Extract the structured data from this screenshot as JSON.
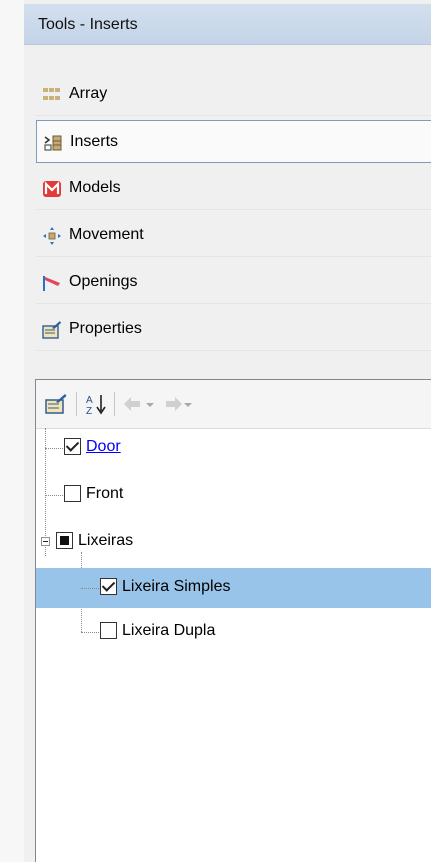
{
  "window": {
    "title": "Tools - Inserts"
  },
  "tools": {
    "items": [
      {
        "label": "Array",
        "icon": "array-icon"
      },
      {
        "label": "Inserts",
        "icon": "inserts-icon",
        "selected": true
      },
      {
        "label": "Models",
        "icon": "models-icon"
      },
      {
        "label": "Movement",
        "icon": "movement-icon"
      },
      {
        "label": "Openings",
        "icon": "openings-icon"
      },
      {
        "label": "Properties",
        "icon": "properties-icon"
      }
    ]
  },
  "tree_toolbar": {
    "buttons": [
      "properties-icon",
      "sort-az-icon",
      "back-arrow-icon",
      "forward-arrow-icon"
    ]
  },
  "tree": {
    "nodes": [
      {
        "label": "Door",
        "state": "checked",
        "level": 1,
        "link": true
      },
      {
        "label": "Front",
        "state": "unchecked",
        "level": 1
      },
      {
        "label": "Lixeiras",
        "state": "partial",
        "level": 1,
        "expanded": true
      },
      {
        "label": "Lixeira Simples",
        "state": "checked",
        "level": 2,
        "selected": true
      },
      {
        "label": "Lixeira Dupla",
        "state": "unchecked",
        "level": 2
      }
    ]
  },
  "colors": {
    "title_bar": "#c8d7ea",
    "selection": "#99c4ea",
    "link": "#0000ff",
    "models_icon": "#e03a3a"
  }
}
